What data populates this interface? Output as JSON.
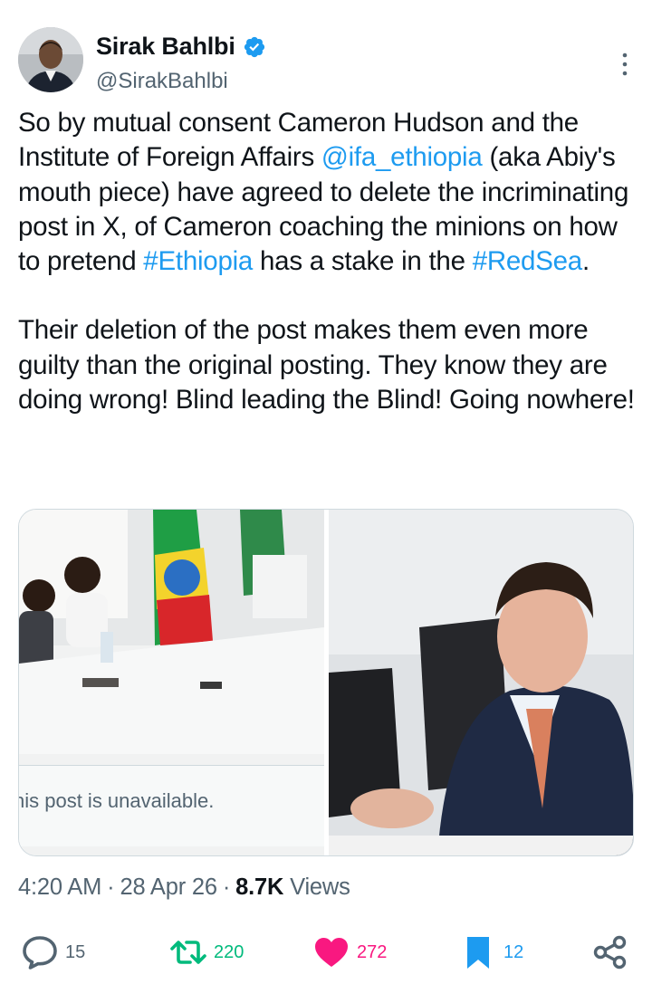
{
  "author": {
    "name": "Sirak Bahlbi",
    "handle": "@SirakBahlbi",
    "verified": true
  },
  "tweet": {
    "paragraph1": {
      "p1": "So by mutual consent Cameron Hudson and the Institute of Foreign Affairs ",
      "mention": "@ifa_ethiopia",
      "p2": " (aka Abiy's mouth piece) have agreed to delete the incriminating post in X, of Cameron coaching the minions on how to pretend ",
      "hashtag1": "#Ethiopia",
      "p3": " has a stake in the ",
      "hashtag2": "#RedSea",
      "p4": "."
    },
    "paragraph2": "Their deletion of the post makes them even more guilty than the original posting. They know they are doing wrong! Blind leading the Blind! Going nowhere!"
  },
  "media": {
    "left_caption": "his post is unavailable."
  },
  "meta": {
    "time": "4:20 AM",
    "date": "28 Apr 26",
    "views_count": "8.7K",
    "views_label": "Views"
  },
  "actions": {
    "replies": "15",
    "retweets": "220",
    "likes": "272",
    "bookmarks": "12"
  },
  "colors": {
    "accent": "#1d9bf0",
    "retweet": "#00ba7c",
    "like": "#f91880",
    "secondary_text": "#536471"
  },
  "icons": [
    "verified-badge-icon",
    "more-icon",
    "reply-icon",
    "retweet-icon",
    "heart-icon",
    "bookmark-icon",
    "share-icon"
  ]
}
